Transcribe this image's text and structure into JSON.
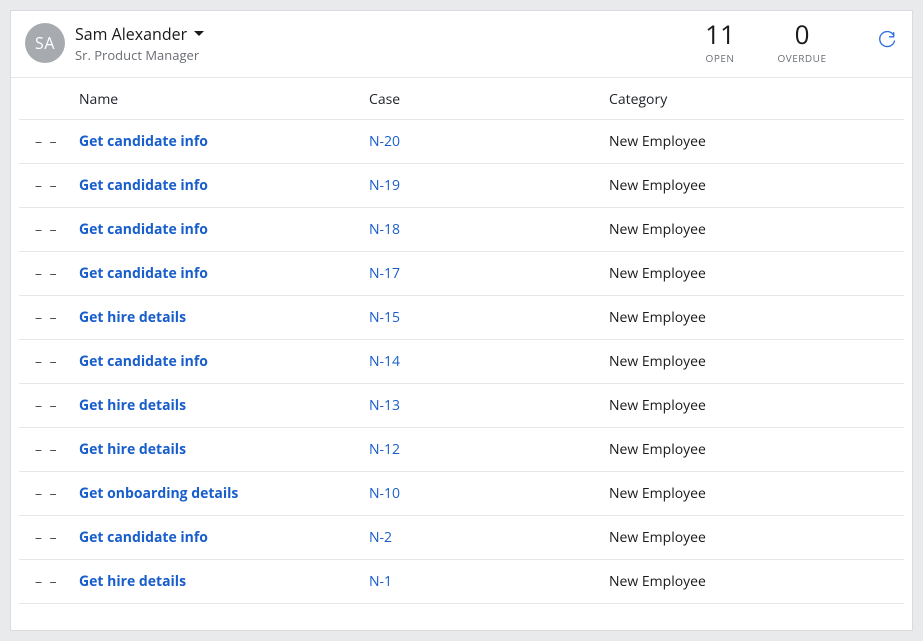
{
  "user": {
    "initials": "SA",
    "name": "Sam Alexander",
    "title": "Sr. Product Manager"
  },
  "stats": {
    "open": {
      "value": "11",
      "label": "OPEN"
    },
    "overdue": {
      "value": "0",
      "label": "OVERDUE"
    }
  },
  "columns": {
    "name": "Name",
    "case": "Case",
    "category": "Category"
  },
  "drag_glyph": "– –",
  "rows": [
    {
      "name": "Get candidate info",
      "case": "N-20",
      "category": "New Employee"
    },
    {
      "name": "Get candidate info",
      "case": "N-19",
      "category": "New Employee"
    },
    {
      "name": "Get candidate info",
      "case": "N-18",
      "category": "New Employee"
    },
    {
      "name": "Get candidate info",
      "case": "N-17",
      "category": "New Employee"
    },
    {
      "name": "Get hire details",
      "case": "N-15",
      "category": "New Employee"
    },
    {
      "name": "Get candidate info",
      "case": "N-14",
      "category": "New Employee"
    },
    {
      "name": "Get hire details",
      "case": "N-13",
      "category": "New Employee"
    },
    {
      "name": "Get hire details",
      "case": "N-12",
      "category": "New Employee"
    },
    {
      "name": "Get onboarding details",
      "case": "N-10",
      "category": "New Employee"
    },
    {
      "name": "Get candidate info",
      "case": "N-2",
      "category": "New Employee"
    },
    {
      "name": "Get hire details",
      "case": "N-1",
      "category": "New Employee"
    }
  ]
}
